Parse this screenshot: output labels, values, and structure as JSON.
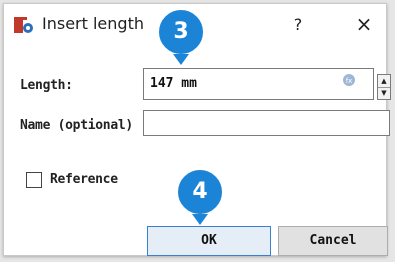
{
  "dialog": {
    "title": "Insert length",
    "help_label": "?",
    "close_label": "×",
    "app_icon_colors": {
      "primary": "#c0392b",
      "secondary": "#2d6fb8"
    }
  },
  "fields": {
    "length": {
      "label": "Length:",
      "value": "147 mm"
    },
    "name": {
      "label": "Name (optional)",
      "value": ""
    }
  },
  "spinner": {
    "up": "▲",
    "down": "▼"
  },
  "reference": {
    "label": "Reference",
    "checked": false
  },
  "buttons": {
    "ok": "OK",
    "cancel": "Cancel"
  },
  "markers": [
    {
      "number": "3"
    },
    {
      "number": "4"
    }
  ],
  "colors": {
    "marker": "#1b84d6",
    "ok_border": "#3c7fd1"
  }
}
